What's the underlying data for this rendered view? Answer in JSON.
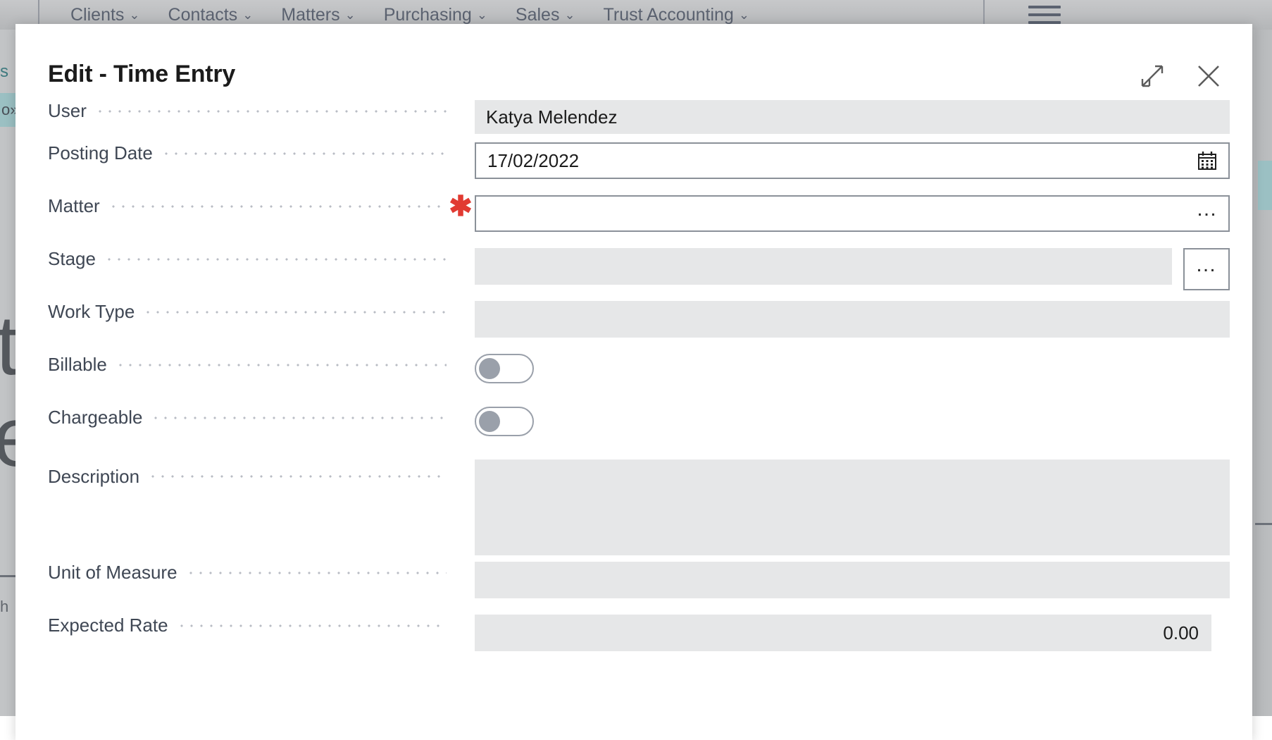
{
  "background": {
    "menu_items": [
      {
        "label": "Clients",
        "caret": "⌄"
      },
      {
        "label": "Contacts",
        "caret": "⌄"
      },
      {
        "label": "Matters",
        "caret": "⌄"
      },
      {
        "label": "Purchasing",
        "caret": "⌄"
      },
      {
        "label": "Sales",
        "caret": "⌄"
      },
      {
        "label": "Trust Accounting",
        "caret": "⌄"
      }
    ],
    "hamburger_name": "hamburger-menu-icon",
    "left_fragment_top": "s",
    "left_fragment_highlight": "o»",
    "left_fragment_big1": "t",
    "left_fragment_big2": "e",
    "left_fragment_small": "h"
  },
  "dialog": {
    "title": "Edit - Time Entry",
    "expand_icon": "expand-icon",
    "close_icon": "close-icon",
    "fields": [
      {
        "label": "User",
        "required": false,
        "type": "text-disabled",
        "value": "Katya Melendez"
      },
      {
        "label": "Posting Date",
        "required": false,
        "type": "date",
        "value": "17/02/2022",
        "button_icon": "calendar-icon"
      },
      {
        "label": "Matter",
        "required": true,
        "required_mark": "✱",
        "type": "lookup",
        "value": "",
        "button_icon": "ellipsis-icon",
        "button_label": "…"
      },
      {
        "label": "Stage",
        "required": false,
        "type": "lookup-disabled",
        "value": "",
        "button_icon": "ellipsis-icon",
        "button_label": "…"
      },
      {
        "label": "Work Type",
        "required": false,
        "type": "text-disabled",
        "value": ""
      },
      {
        "label": "Billable",
        "required": false,
        "type": "toggle",
        "value": "off"
      },
      {
        "label": "Chargeable",
        "required": false,
        "type": "toggle",
        "value": "off"
      },
      {
        "label": "Description",
        "required": false,
        "type": "textarea-disabled",
        "value": ""
      },
      {
        "label": "Unit of Measure",
        "required": false,
        "type": "text-disabled",
        "value": ""
      },
      {
        "label": "Expected Rate",
        "required": false,
        "type": "number-disabled",
        "value": "0.00"
      }
    ]
  },
  "colors": {
    "accent_teal": "#9bc0c3",
    "required_red": "#e13a32",
    "disabled_field": "#e6e7e8",
    "field_border": "#8b9199",
    "label_text": "#3f4754",
    "menubar_text": "#5b6270"
  }
}
